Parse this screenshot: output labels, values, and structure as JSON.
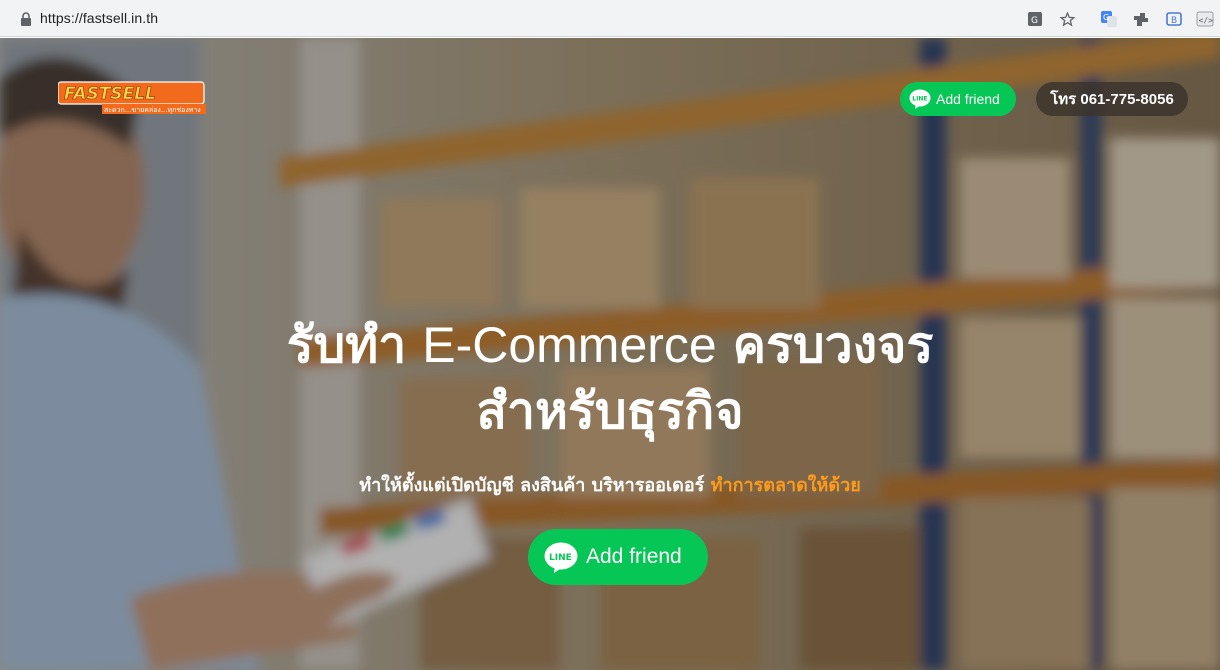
{
  "browser": {
    "url": "https://fastsell.in.th",
    "icons": [
      "lock-icon",
      "translate-icon",
      "bookmark-star-icon",
      "google-translate-extension-icon",
      "extension-icon",
      "ext-box-icon",
      "code-icon"
    ]
  },
  "header": {
    "logo_text": "FASTSELL",
    "logo_tagline": "สะดวก...ขายคล่อง...ทุกช่องทาง",
    "line_button_label": "Add friend",
    "phone_label": "โทร 061-775-8056"
  },
  "hero": {
    "headline_part1": "รับทำ",
    "headline_part2": "E-Commerce",
    "headline_part3": "ครบวงจร",
    "headline_line2": "สำหรับธุรกิจ",
    "subline_main": "ทำให้ตั้งแต่เปิดบัญชี ลงสินค้า บริหารออเดอร์",
    "subline_accent": "ทำการตลาดให้ด้วย",
    "cta_label": "Add friend",
    "cta_icon_text": "LINE"
  },
  "colors": {
    "line_green": "#06c755",
    "accent_orange": "#ff9a1a",
    "logo_orange": "#f26a1b"
  }
}
